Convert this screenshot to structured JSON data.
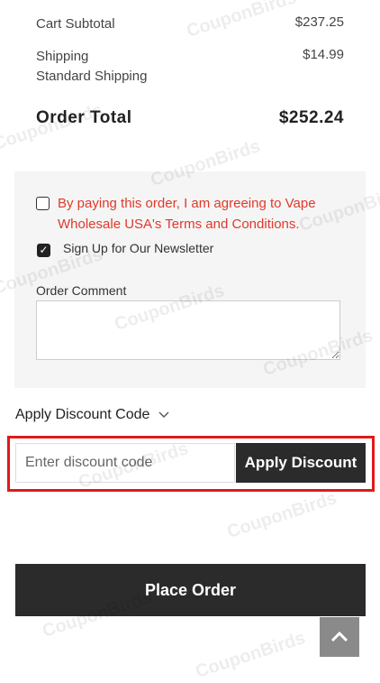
{
  "summary": {
    "subtotal_label": "Cart Subtotal",
    "subtotal_value": "$237.25",
    "shipping_label": "Shipping",
    "shipping_method": "Standard Shipping",
    "shipping_value": "$14.99",
    "total_label": "Order Total",
    "total_value": "$252.24"
  },
  "panel": {
    "agree_text": "By paying this order, I am agreeing to Vape Wholesale USA's Terms and Conditions.",
    "agree_checked": false,
    "newsletter_label": "Sign Up for Our Newsletter",
    "newsletter_checked": true,
    "comment_label": "Order Comment",
    "comment_value": ""
  },
  "discount": {
    "toggle_label": "Apply Discount Code",
    "input_placeholder": "Enter discount code",
    "apply_label": "Apply Discount"
  },
  "place_order_label": "Place Order",
  "watermark": "CouponBirds",
  "colors": {
    "accent_red": "#e01a1a",
    "dark_button": "#2b2b2b",
    "terms_text": "#e0392b",
    "panel_bg": "#f5f5f5"
  }
}
